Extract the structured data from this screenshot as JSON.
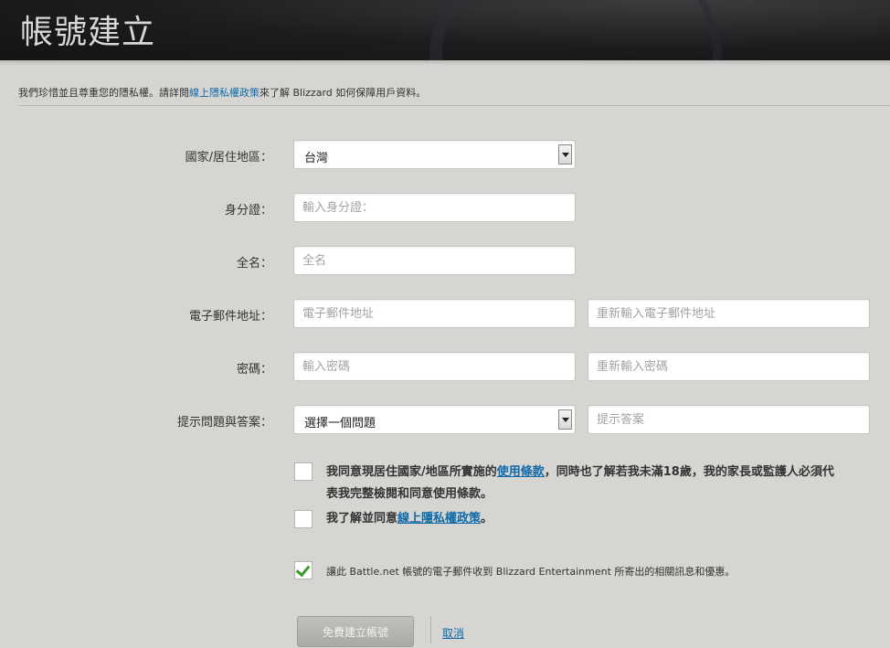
{
  "header": {
    "title": "帳號建立"
  },
  "privacy": {
    "prefix": "我們珍惜並且尊重您的隱私權。請詳閱",
    "link": "線上隱私權政策",
    "suffix": "來了解 Blizzard 如何保障用戶資料。"
  },
  "form": {
    "country": {
      "label": "國家/居住地區：",
      "value": "台灣"
    },
    "id_number": {
      "label": "身分證：",
      "placeholder": "輸入身分證："
    },
    "full_name": {
      "label": "全名：",
      "placeholder": "全名"
    },
    "email": {
      "label": "電子郵件地址：",
      "placeholder": "電子郵件地址",
      "confirm_placeholder": "重新輸入電子郵件地址"
    },
    "password": {
      "label": "密碼：",
      "placeholder": "輸入密碼",
      "confirm_placeholder": "重新輸入密碼"
    },
    "security": {
      "label": "提示問題與答案：",
      "question_value": "選擇一個問題",
      "answer_placeholder": "提示答案"
    }
  },
  "agreements": {
    "terms_part1": "我同意現居住國家/地區所實施的",
    "terms_link": "使用條款",
    "terms_part2": "，同時也了解若我未滿18歲，我的家長或監護人必須代",
    "terms_line2": "表我完整檢閱和同意使用條款。",
    "privacy_part1": "我了解並同意",
    "privacy_link": "線上隱私權政策",
    "privacy_part2": "。",
    "promo": "讓此 Battle.net 帳號的電子郵件收到 Blizzard Entertainment 所寄出的相關訊息和優惠。",
    "terms_checked": false,
    "privacy_checked": false,
    "promo_checked": true
  },
  "actions": {
    "create": "免費建立帳號",
    "cancel": "取消"
  },
  "colors": {
    "link": "#0f6aa8",
    "check": "#3c9a2b",
    "background": "#d6d5d2"
  },
  "icons": {
    "dropdown": "chevron-down-icon",
    "checkmark": "checkmark-icon"
  }
}
